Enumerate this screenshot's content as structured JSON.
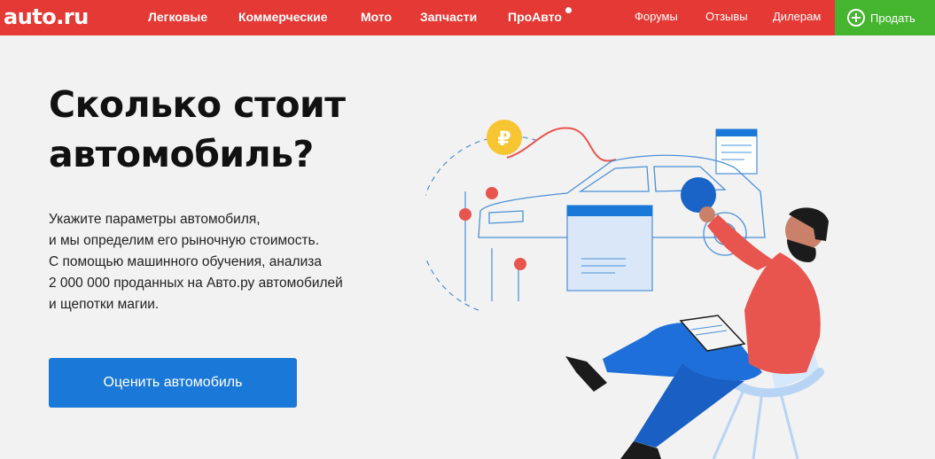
{
  "header": {
    "logo": "auto.ru",
    "nav_main": [
      "Легковые",
      "Коммерческие",
      "Мото",
      "Запчасти",
      "ПроАвто"
    ],
    "nav_secondary": [
      "Форумы",
      "Отзывы",
      "Дилерам"
    ],
    "sell_label": "Продать"
  },
  "hero": {
    "title": "Сколько стоит автомобиль?",
    "description_lines": [
      "Укажите параметры автомобиля,",
      "и мы определим его рыночную стоимость.",
      "С помощью машинного обучения, анализа",
      "2 000 000 проданных на Авто.ру автомобилей",
      "и щепотки магии."
    ],
    "cta_label": "Оценить автомобиль"
  },
  "illustration": {
    "currency_symbol": "₽"
  },
  "colors": {
    "brand_red": "#e53935",
    "sell_green": "#45b42e",
    "cta_blue": "#1a79d8",
    "background": "#f2f2f2"
  }
}
